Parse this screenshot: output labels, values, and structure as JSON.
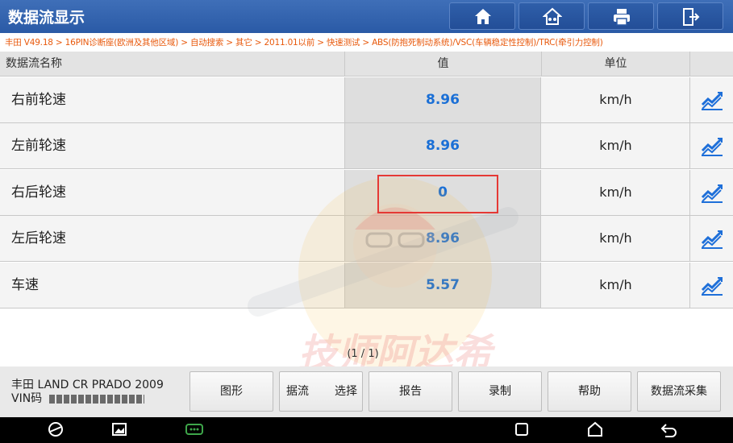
{
  "header": {
    "title": "数据流显示",
    "buttons": [
      "home-icon",
      "vehicle-home-icon",
      "print-icon",
      "exit-icon"
    ]
  },
  "breadcrumb": "丰田 V49.18 > 16PIN诊断座(欧洲及其他区域) > 自动搜索 > 其它 > 2011.01以前 > 快速测试 > ABS(防抱死制动系统)/VSC(车辆稳定性控制)/TRC(牵引力控制)",
  "table": {
    "headers": {
      "name": "数据流名称",
      "value": "值",
      "unit": "单位"
    },
    "rows": [
      {
        "name": "右前轮速",
        "value": "8.96",
        "unit": "km/h"
      },
      {
        "name": "左前轮速",
        "value": "8.96",
        "unit": "km/h"
      },
      {
        "name": "右后轮速",
        "value": "0",
        "unit": "km/h"
      },
      {
        "name": "左后轮速",
        "value": "8.96",
        "unit": "km/h"
      },
      {
        "name": "车速",
        "value": "5.57",
        "unit": "km/h"
      }
    ]
  },
  "page_indicator": "(1 / 1)",
  "vehicle": {
    "model": "丰田 LAND CR PRADO 2009",
    "vin_label": "VIN码"
  },
  "buttons": {
    "graph": "图形",
    "select_left": "据流",
    "select_right": "选择",
    "report": "报告",
    "record": "录制",
    "help": "帮助",
    "collect": "数据流采集"
  },
  "watermark_text": "技师阿达希",
  "colors": {
    "title_bar": "#2f61ad",
    "value_text": "#1a6fd6",
    "breadcrumb_text": "#e8590c",
    "highlight": "#e53935"
  }
}
